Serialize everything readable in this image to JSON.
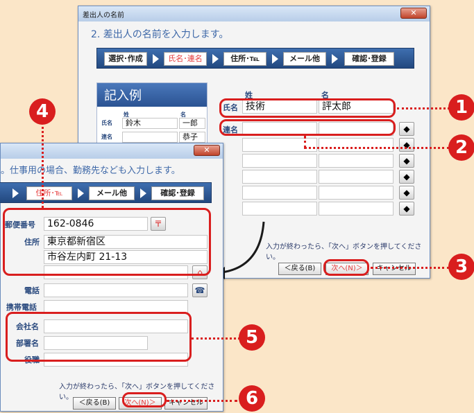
{
  "back_window": {
    "title": "差出人の名前",
    "heading": "2. 差出人の名前を入力します。",
    "steps": [
      "選択･作成",
      "氏名･連名",
      "住所･℡",
      "メール他",
      "確認･登録"
    ],
    "example": {
      "title": "記入例",
      "sei_label": "姓",
      "mei_label": "名",
      "shimei_label": "氏名",
      "renmei_label": "連名",
      "sei_value": "鈴木",
      "mei_value": "一郎",
      "renmei_value": "恭子"
    },
    "col_sei": "姓",
    "col_mei": "名",
    "shimei_label": "氏名",
    "renmei_label": "連名",
    "sei_value": "技術",
    "mei_value": "評太郎",
    "note": "入力が終わったら、「次へ」ボタンを押してください。",
    "back_btn": "＜戻る(B)",
    "next_btn": "次へ(N)＞",
    "cancel_btn": "キャンセル"
  },
  "front_window": {
    "heading": "。仕事用の場合、勤務先なども入力します。",
    "steps": [
      "住所･℡",
      "メール他",
      "確認･登録"
    ],
    "postal_label": "郵便番号",
    "postal_value": "162-0846",
    "address_label": "住所",
    "address1": "東京都新宿区",
    "address2": "市谷左内町 21-13",
    "phone_label": "電話",
    "mobile_label": "携帯電話",
    "company_label": "会社名",
    "dept_label": "部署名",
    "title_label": "役職",
    "note": "入力が終わったら、「次へ」ボタンを押してください。",
    "back_btn": "＜戻る(B)",
    "next_btn": "次へ(N)＞",
    "cancel_btn": "キャンセル"
  },
  "callouts": [
    "1",
    "2",
    "3",
    "4",
    "5",
    "6"
  ],
  "colors": {
    "accent": "#d91e1e",
    "step_bar": "#2a5292",
    "background": "#fbe6c8"
  }
}
